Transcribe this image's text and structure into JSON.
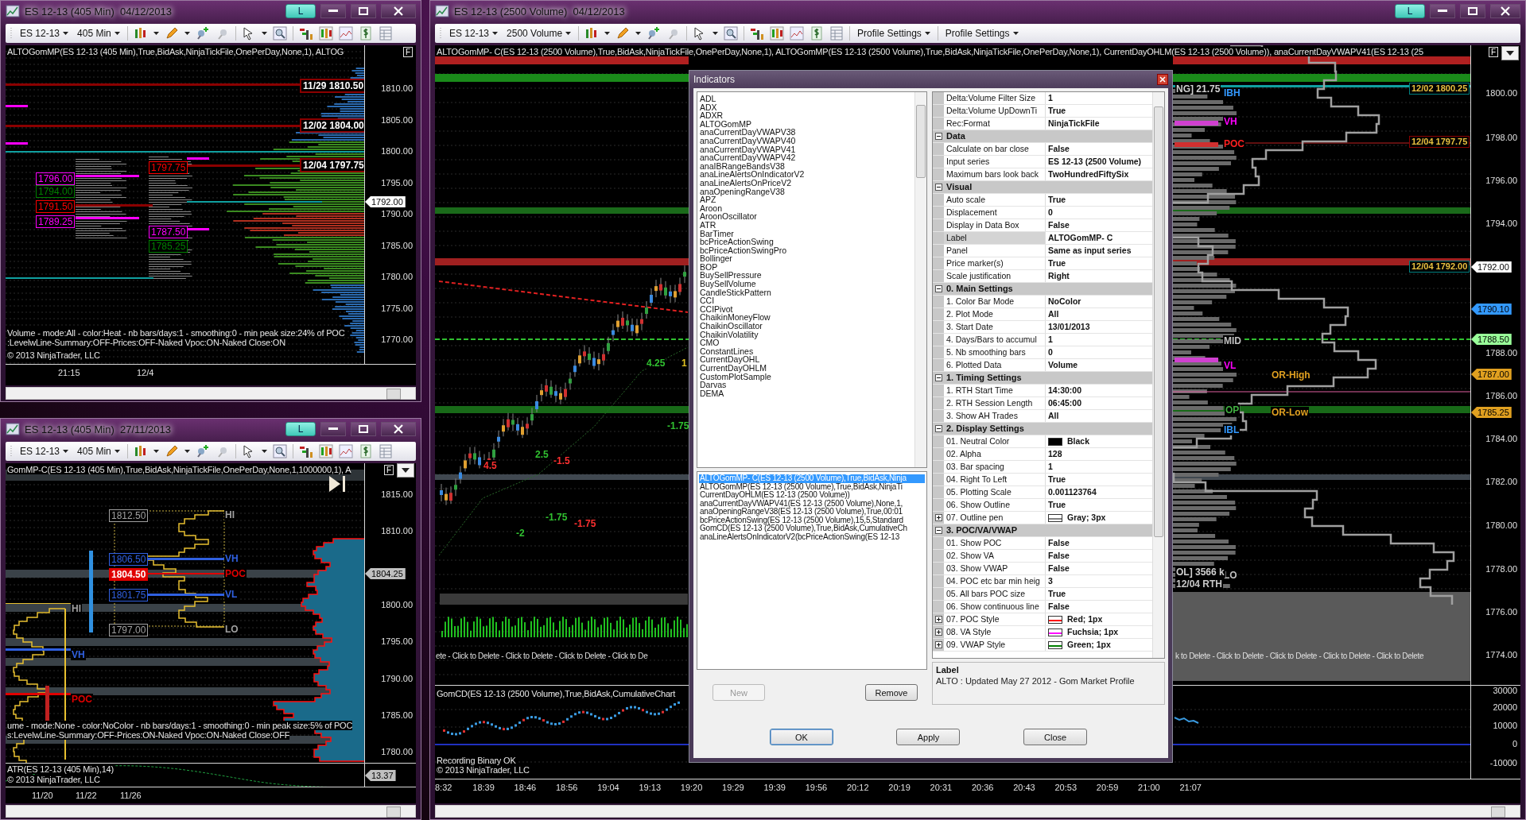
{
  "windows": [
    {
      "title": "ES 12-13 (405 Min)  04/12/2013",
      "link": "L",
      "toolbar": {
        "instrument": "ES 12-13",
        "period": "405 Min"
      },
      "header": "ALTOGomMP(ES 12-13 (405 Min),True,BidAsk,NinjaTickFile,OnePerDay,None,1), ALTOG",
      "flag": "F",
      "labels": [
        {
          "text": "11/29 1810.50",
          "kind": "date-level",
          "color": "#8b0000"
        },
        {
          "text": "12/02 1804.00",
          "kind": "date-level",
          "color": "#8b0000"
        },
        {
          "text": "12/04 1797.75",
          "kind": "date-level",
          "color": "#8b0000"
        },
        {
          "text": "1796.00",
          "kind": "boxed",
          "color": "#ff00ff"
        },
        {
          "text": "1794.00",
          "kind": "boxed",
          "color": "#008000"
        },
        {
          "text": "1791.50",
          "kind": "boxed",
          "color": "#ff0000"
        },
        {
          "text": "1789.25",
          "kind": "boxed",
          "color": "#ff00ff"
        },
        {
          "text": "1797.75",
          "kind": "boxed",
          "color": "#ff0000"
        },
        {
          "text": "1787.50",
          "kind": "boxed",
          "color": "#ff00ff"
        },
        {
          "text": "1785.25",
          "kind": "boxed",
          "color": "#008000"
        }
      ],
      "notes": [
        "Volume - mode:All - color:Heat - nb bars/days:1 - smoothing:0 - min peak size:24% of POC",
        ":LevelwLine-Summary:OFF-Prices:OFF-Naked Vpoc:ON-Naked Close:ON"
      ],
      "copyright": "© 2013 NinjaTrader, LLC",
      "price_axis": [
        {
          "text": "1810.00",
          "kind": "tick"
        },
        {
          "text": "1805.00",
          "kind": "tick"
        },
        {
          "text": "1800.00",
          "kind": "tick"
        },
        {
          "text": "1795.00",
          "kind": "tick"
        },
        {
          "text": "1792.00",
          "kind": "marker",
          "color": "#ffffff"
        },
        {
          "text": "1790.00",
          "kind": "tick"
        },
        {
          "text": "1785.00",
          "kind": "tick"
        },
        {
          "text": "1780.00",
          "kind": "tick"
        },
        {
          "text": "1775.00",
          "kind": "tick"
        },
        {
          "text": "1770.00",
          "kind": "tick"
        }
      ],
      "time_axis": [
        "21:15",
        "12/4"
      ]
    },
    {
      "title": "ES 12-13 (405 Min)  27/11/2013",
      "link": "L",
      "toolbar": {
        "instrument": "ES 12-13",
        "period": "405 Min"
      },
      "header": "GomMP-C(ES 12-13 (405 Min),True,BidAsk,NinjaTickFile,OnePerDay,None,1,1000000,1), A",
      "flag": "F",
      "labels": [
        {
          "text": "1812.50",
          "kind": "boxed",
          "color": "#a0a0a0"
        },
        {
          "text": "1806.50",
          "kind": "boxed",
          "color": "#3060e0"
        },
        {
          "text": "1804.50",
          "kind": "filled",
          "color": "#e00000"
        },
        {
          "text": "1801.75",
          "kind": "boxed",
          "color": "#3060e0"
        },
        {
          "text": "1797.00",
          "kind": "boxed",
          "color": "#a0a0a0"
        },
        {
          "text": "HI",
          "kind": "plain",
          "color": "#a0a0a0"
        },
        {
          "text": "VH",
          "kind": "plain",
          "color": "#3060e0"
        },
        {
          "text": "POC",
          "kind": "plain",
          "color": "#e00000"
        },
        {
          "text": "VL",
          "kind": "plain",
          "color": "#3060e0"
        },
        {
          "text": "LO",
          "kind": "plain",
          "color": "#a0a0a0"
        },
        {
          "text": "HI",
          "kind": "plain",
          "color": "#a0a0a0"
        },
        {
          "text": "VH",
          "kind": "plain",
          "color": "#3060e0"
        },
        {
          "text": "POC",
          "kind": "plain",
          "color": "#e00000"
        }
      ],
      "notes": [
        "ume - mode:None - color:NoColor - nb bars/days:1 - smoothing:0 - min peak size:5% of POC",
        "s:LevelwLine-Summary:OFF-Prices:ON-Naked Vpoc:ON-Naked Close:OFF"
      ],
      "copyright": "© 2013 NinjaTrader, LLC",
      "price_axis": [
        {
          "text": "1815.00",
          "kind": "tick"
        },
        {
          "text": "1810.00",
          "kind": "tick"
        },
        {
          "text": "1804.25",
          "kind": "marker",
          "color": "#c0c0c0"
        },
        {
          "text": "1800.00",
          "kind": "tick"
        },
        {
          "text": "1795.00",
          "kind": "tick"
        },
        {
          "text": "1790.00",
          "kind": "tick"
        },
        {
          "text": "1785.00",
          "kind": "tick"
        },
        {
          "text": "1780.00",
          "kind": "tick"
        }
      ],
      "lower_panel": {
        "title": "ATR(ES 12-13 (405 Min),14)",
        "axis": [
          {
            "text": "13.37",
            "kind": "marker",
            "color": "#c0c0c0"
          }
        ]
      },
      "time_axis": [
        "11/20",
        "11/22",
        "11/26"
      ]
    },
    {
      "title": "ES 12-13 (2500 Volume)  04/12/2013",
      "link": "L",
      "toolbar": {
        "instrument": "ES 12-13",
        "period": "2500 Volume",
        "menus": [
          "Profile Settings",
          "Profile Settings"
        ]
      },
      "header": "ALTOGomMP- C(ES 12-13 (2500 Volume),True,BidAsk,NinjaTickFile,OnePerDay,None,1), ALTOGomMP(ES 12-13 (2500 Volume),True,BidAsk,NinjaTickFile,OnePerDay,None,1), CurrentDayOHLM(ES 12-13 (2500 Volume)), anaCurrentDayVWAPV41(ES 12-13 (25",
      "flag": "F",
      "labels": [
        {
          "text": "NG] 21.75",
          "kind": "plain",
          "color": "#d0d0d0"
        },
        {
          "text": "IBH",
          "kind": "plain",
          "color": "#3399ff"
        },
        {
          "text": "VH",
          "kind": "plain",
          "color": "#ff00ff"
        },
        {
          "text": "POC",
          "kind": "plain",
          "color": "#ff2020"
        },
        {
          "text": "MID",
          "kind": "plain",
          "color": "#c0c0c0"
        },
        {
          "text": "VL",
          "kind": "plain",
          "color": "#ff00ff"
        },
        {
          "text": "OR-High",
          "kind": "plain",
          "color": "#e0a020"
        },
        {
          "text": "OP",
          "kind": "plain",
          "color": "#40b040"
        },
        {
          "text": "OR-Low",
          "kind": "plain",
          "color": "#e0a020"
        },
        {
          "text": "IBL",
          "kind": "plain",
          "color": "#3399ff"
        },
        {
          "text": "LO",
          "kind": "plain",
          "color": "#c0c0c0"
        },
        {
          "text": "12/02 1800.25",
          "kind": "gold-level",
          "color": "#008080"
        },
        {
          "text": "12/04 1797.75",
          "kind": "gold-level",
          "color": "#8b0000"
        },
        {
          "text": "12/04 1792.00",
          "kind": "gold-level",
          "color": "#008080"
        },
        {
          "text": "OL] 3566 k",
          "kind": "plain",
          "color": "#d0d0d0"
        },
        {
          "text": "12/04 RTH",
          "kind": "plain",
          "color": "#c8c8c8"
        },
        {
          "text": "4.25",
          "kind": "plain",
          "color": "#30c030"
        },
        {
          "text": "1",
          "kind": "plain",
          "color": "#e0c020"
        },
        {
          "text": "4.5",
          "kind": "plain",
          "color": "#ff3030"
        },
        {
          "text": "2.5",
          "kind": "plain",
          "color": "#30c030"
        },
        {
          "text": "-1.5",
          "kind": "plain",
          "color": "#ff3030"
        },
        {
          "text": "-1.75",
          "kind": "plain",
          "color": "#30c030"
        },
        {
          "text": "-2",
          "kind": "plain",
          "color": "#30c030"
        },
        {
          "text": "-1.75",
          "kind": "plain",
          "color": "#30c030"
        },
        {
          "text": "-1.75",
          "kind": "plain",
          "color": "#ff3030"
        }
      ],
      "delete_texts": [
        "ete - Click to Delete - Click to Delete - Click to Delete - Click to De",
        "k to Delete - Click to Delete - Click to Delete - Click to Delete - Click to Delete"
      ],
      "copyright": "© 2013 NinjaTrader, LLC",
      "price_axis": [
        {
          "text": "1800.00",
          "kind": "tick"
        },
        {
          "text": "1798.00",
          "kind": "tick"
        },
        {
          "text": "1796.00",
          "kind": "tick"
        },
        {
          "text": "1794.00",
          "kind": "tick"
        },
        {
          "text": "1792.00",
          "kind": "marker",
          "color": "#ffffff"
        },
        {
          "text": "1790.10",
          "kind": "marker",
          "color": "#3399ff"
        },
        {
          "text": "1788.50",
          "kind": "marker",
          "color": "#99ff99"
        },
        {
          "text": "1788.00",
          "kind": "tick"
        },
        {
          "text": "1787.00",
          "kind": "marker",
          "color": "#e0a020"
        },
        {
          "text": "1786.00",
          "kind": "tick"
        },
        {
          "text": "1785.25",
          "kind": "marker",
          "color": "#e0a020"
        },
        {
          "text": "1784.00",
          "kind": "tick"
        },
        {
          "text": "1782.00",
          "kind": "tick"
        },
        {
          "text": "1780.00",
          "kind": "tick"
        },
        {
          "text": "1778.00",
          "kind": "tick"
        },
        {
          "text": "1776.00",
          "kind": "tick"
        },
        {
          "text": "1774.00",
          "kind": "tick"
        }
      ],
      "lower_panel": {
        "title": "GomCD(ES 12-13 (2500 Volume),True,BidAsk,CumulativeChart",
        "status": "Recording Binary OK",
        "axis": [
          {
            "text": "30000",
            "kind": "tick"
          },
          {
            "text": "20000",
            "kind": "tick"
          },
          {
            "text": "10000",
            "kind": "tick"
          },
          {
            "text": "0",
            "kind": "tick"
          },
          {
            "text": "-10000",
            "kind": "tick"
          }
        ]
      },
      "time_axis": [
        "8:32",
        "18:39",
        "18:46",
        "18:56",
        "19:04",
        "19:13",
        "19:20",
        "19:29",
        "19:39",
        "19:56",
        "20:12",
        "20:19",
        "20:31",
        "20:36",
        "20:43",
        "20:53",
        "20:59",
        "21:00",
        "21:07"
      ]
    }
  ],
  "dialog": {
    "title": "Indicators",
    "available": [
      "ADL",
      "ADX",
      "ADXR",
      "ALTOGomMP",
      "anaCurrentDayVWAPV38",
      "anaCurrentDayVWAPV40",
      "anaCurrentDayVWAPV41",
      "anaCurrentDayVWAPV42",
      "anaIBRangeBandsV38",
      "anaLineAlertsOnIndicatorV2",
      "anaLineAlertsOnPriceV2",
      "anaOpeningRangeV38",
      "APZ",
      "Aroon",
      "AroonOscillator",
      "ATR",
      "BarTimer",
      "bcPriceActionSwing",
      "bcPriceActionSwingPro",
      "Bollinger",
      "BOP",
      "BuySellPressure",
      "BuySellVolume",
      "CandleStickPattern",
      "CCI",
      "CCIPivot",
      "ChaikinMoneyFlow",
      "ChaikinOscillator",
      "ChaikinVolatility",
      "CMO",
      "ConstantLines",
      "CurrentDayOHL",
      "CurrentDayOHLM",
      "CustomPlotSample",
      "Darvas",
      "DEMA"
    ],
    "applied": [
      {
        "text": "ALTOGomMP- C(ES 12-13 (2500 Volume),True,BidAsk,Ninja",
        "selected": true
      },
      {
        "text": "ALTOGomMP(ES 12-13 (2500 Volume),True,BidAsk,NinjaTi",
        "selected": false
      },
      {
        "text": "CurrentDayOHLM(ES 12-13 (2500 Volume))",
        "selected": false
      },
      {
        "text": "anaCurrentDayVWAPV41(ES 12-13 (2500 Volume),None,1,",
        "selected": false
      },
      {
        "text": "anaOpeningRangeV38(ES 12-13 (2500 Volume),True,00:01",
        "selected": false
      },
      {
        "text": "bcPriceActionSwing(ES 12-13 (2500 Volume),15,5,Standard",
        "selected": false
      },
      {
        "text": "GomCD(ES 12-13 (2500 Volume),True,BidAsk,CumulativeCh",
        "selected": false
      },
      {
        "text": "anaLineAlertsOnIndicatorV2(bcPriceActionSwing(ES 12-13",
        "selected": false
      }
    ],
    "buttons": [
      {
        "label": "New",
        "disabled": true
      },
      {
        "label": "Remove",
        "disabled": false
      }
    ],
    "properties": [
      {
        "kind": "row",
        "name": "Delta:Volume Filter Size",
        "value": "1",
        "selected": false,
        "expandable": false
      },
      {
        "kind": "row",
        "name": "Delta:Volume UpDownTi",
        "value": "True",
        "selected": false,
        "expandable": false
      },
      {
        "kind": "row",
        "name": "Rec:Format",
        "value": "NinjaTickFile",
        "selected": false,
        "expandable": false
      },
      {
        "kind": "category",
        "name": "Data",
        "expanded": true
      },
      {
        "kind": "row",
        "name": "Calculate on bar close",
        "value": "False",
        "selected": false,
        "expandable": false
      },
      {
        "kind": "row",
        "name": "Input series",
        "value": "ES 12-13 (2500 Volume)",
        "selected": false,
        "expandable": false
      },
      {
        "kind": "row",
        "name": "Maximum bars look back",
        "value": "TwoHundredFiftySix",
        "selected": false,
        "expandable": false
      },
      {
        "kind": "category",
        "name": "Visual",
        "expanded": true
      },
      {
        "kind": "row",
        "name": "Auto scale",
        "value": "True",
        "selected": false,
        "expandable": false
      },
      {
        "kind": "row",
        "name": "Displacement",
        "value": "0",
        "selected": false,
        "expandable": false
      },
      {
        "kind": "row",
        "name": "Display in Data Box",
        "value": "False",
        "selected": false,
        "expandable": false
      },
      {
        "kind": "row",
        "name": "Label",
        "value": "ALTOGomMP- C",
        "selected": true,
        "expandable": false
      },
      {
        "kind": "row",
        "name": "Panel",
        "value": "Same as input series",
        "selected": false,
        "expandable": false
      },
      {
        "kind": "row",
        "name": "Price marker(s)",
        "value": "True",
        "selected": false,
        "expandable": false
      },
      {
        "kind": "row",
        "name": "Scale justification",
        "value": "Right",
        "selected": false,
        "expandable": false
      },
      {
        "kind": "category",
        "name": "0. Main Settings",
        "expanded": true
      },
      {
        "kind": "row",
        "name": "1. Color Bar Mode",
        "value": "NoColor",
        "selected": false,
        "expandable": false
      },
      {
        "kind": "row",
        "name": "2. Plot Mode",
        "value": "All",
        "selected": false,
        "expandable": false
      },
      {
        "kind": "row",
        "name": "3. Start Date",
        "value": "13/01/2013",
        "selected": false,
        "expandable": false
      },
      {
        "kind": "row",
        "name": "4. Days/Bars to accumul",
        "value": "1",
        "selected": false,
        "expandable": false
      },
      {
        "kind": "row",
        "name": "5. Nb smoothing bars",
        "value": "0",
        "selected": false,
        "expandable": false
      },
      {
        "kind": "row",
        "name": "6. Plotted Data",
        "value": "Volume",
        "selected": false,
        "expandable": false
      },
      {
        "kind": "category",
        "name": "1. Timing Settings",
        "expanded": true
      },
      {
        "kind": "row",
        "name": "1. RTH Start Time",
        "value": "14:30:00",
        "selected": false,
        "expandable": false
      },
      {
        "kind": "row",
        "name": "2. RTH Session Length",
        "value": "06:45:00",
        "selected": false,
        "expandable": false
      },
      {
        "kind": "row",
        "name": "3. Show AH Trades",
        "value": "All",
        "selected": false,
        "expandable": false
      },
      {
        "kind": "category",
        "name": "2. Display Settings",
        "expanded": true
      },
      {
        "kind": "row",
        "name": "01. Neutral Color",
        "value": "Black",
        "selected": false,
        "expandable": false,
        "swatch": {
          "kind": "fill",
          "color": "#000000"
        }
      },
      {
        "kind": "row",
        "name": "02. Alpha",
        "value": "128",
        "selected": false,
        "expandable": false
      },
      {
        "kind": "row",
        "name": "03. Bar spacing",
        "value": "1",
        "selected": false,
        "expandable": false
      },
      {
        "kind": "row",
        "name": "04. Right To Left",
        "value": "True",
        "selected": false,
        "expandable": false
      },
      {
        "kind": "row",
        "name": "05. Plotting Scale",
        "value": "0.001123764",
        "selected": false,
        "expandable": false
      },
      {
        "kind": "row",
        "name": "06. Show Outline",
        "value": "True",
        "selected": false,
        "expandable": false
      },
      {
        "kind": "row",
        "name": "07. Outline pen",
        "value": "Gray; 3px",
        "selected": false,
        "expandable": true,
        "swatch": {
          "kind": "pen",
          "color": "#808080"
        }
      },
      {
        "kind": "category",
        "name": "3. POC/VA/VWAP",
        "expanded": true
      },
      {
        "kind": "row",
        "name": "01. Show POC",
        "value": "False",
        "selected": false,
        "expandable": false
      },
      {
        "kind": "row",
        "name": "02. Show VA",
        "value": "False",
        "selected": false,
        "expandable": false
      },
      {
        "kind": "row",
        "name": "03. Show VWAP",
        "value": "False",
        "selected": false,
        "expandable": false
      },
      {
        "kind": "row",
        "name": "04. POC etc bar min heig",
        "value": "3",
        "selected": false,
        "expandable": false
      },
      {
        "kind": "row",
        "name": "05. All bars POC size",
        "value": "True",
        "selected": false,
        "expandable": false
      },
      {
        "kind": "row",
        "name": "06. Show continuous line",
        "value": "False",
        "selected": false,
        "expandable": false
      },
      {
        "kind": "row",
        "name": "07. POC Style",
        "value": "Red; 1px",
        "selected": false,
        "expandable": true,
        "swatch": {
          "kind": "pen",
          "color": "#ff0000"
        }
      },
      {
        "kind": "row",
        "name": "08. VA Style",
        "value": "Fuchsia; 1px",
        "selected": false,
        "expandable": true,
        "swatch": {
          "kind": "pen",
          "color": "#ff00ff"
        }
      },
      {
        "kind": "row",
        "name": "09. VWAP Style",
        "value": "Green; 1px",
        "selected": false,
        "expandable": true,
        "swatch": {
          "kind": "pen",
          "color": "#008000"
        }
      }
    ],
    "description": {
      "title": "Label",
      "text": "ALTO : Updated May 27 2012 - Gom Market Profile"
    },
    "actions": [
      {
        "label": "OK",
        "default": true
      },
      {
        "label": "Apply",
        "default": false
      },
      {
        "label": "Close",
        "default": false
      }
    ]
  }
}
